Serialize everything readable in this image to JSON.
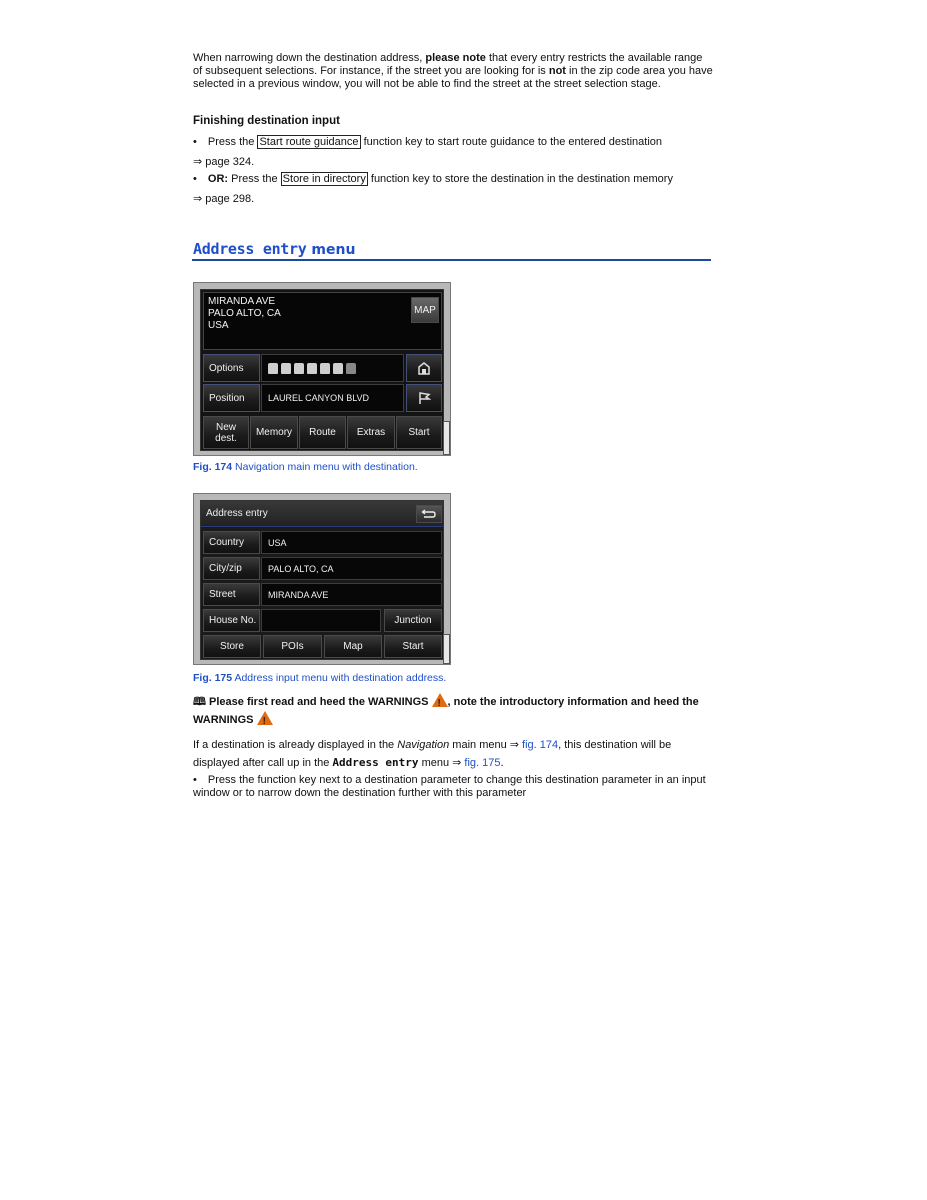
{
  "intro": {
    "p1_a": "When narrowing down the destination address, ",
    "p1_bold1": "please note",
    "p1_b": " that every entry restricts the available range of subsequent selections. For instance, if the street you are looking for is ",
    "p1_bold2": "not",
    "p1_c": " in the zip code area you have selected in a previous window, you will not be able to find the street at the street selection stage."
  },
  "finishing": {
    "heading": "Finishing destination input",
    "bullet1": {
      "pre": "Press the ",
      "key": "Start route guidance",
      "post": " function key to start route guidance to the entered destination",
      "ref": "⇒ page 324."
    },
    "bullet2": {
      "bold": "OR:",
      "pre": " Press the ",
      "key": "Store in directory",
      "post": " function key to store the destination in the destination memory",
      "ref": "⇒ page 298."
    }
  },
  "section": {
    "title_mono": "Address entry",
    "title_sans": " menu"
  },
  "fig174": {
    "destination_lines": [
      "MIRANDA AVE",
      "PALO ALTO, CA",
      "USA"
    ],
    "map_button": "MAP",
    "options_label": "Options",
    "position_label": "Position",
    "position_value": "LAUREL CANYON BLVD",
    "poi_icons": [
      "fuel-station-icon",
      "restaurant-icon",
      "parking-icon",
      "hotel-icon",
      "airport-icon",
      "information-icon",
      "landmark-icon"
    ],
    "bottom_buttons": [
      "New\ndest.",
      "Memory",
      "Route",
      "Extras",
      "Start"
    ],
    "caption_num": "Fig. 174",
    "caption_text": " Navigation main menu with destination."
  },
  "fig175": {
    "title": "Address entry",
    "rows": [
      {
        "label": "Country",
        "value": "USA"
      },
      {
        "label": "City/zip",
        "value": "PALO ALTO, CA"
      },
      {
        "label": "Street",
        "value": "MIRANDA AVE"
      },
      {
        "label": "House No.",
        "value": ""
      }
    ],
    "junction_button": "Junction",
    "bottom_buttons": [
      "Store",
      "POIs",
      "Map",
      "Start"
    ],
    "caption_num": "Fig. 175",
    "caption_text": " Address input menu with destination address."
  },
  "warning": {
    "book_icon": "🕮",
    "text_a": " Please first read and heed the WARNINGS ",
    "text_b": ", note the introductory information and heed the WARNINGS "
  },
  "para2": {
    "a": "If a destination is already displayed in the ",
    "italic": "Navigation",
    "b": " main menu ⇒ ",
    "link1": "fig. 174",
    "c": ", this destination will be displayed after call up in the ",
    "mono": "Address entry",
    "d": " menu ⇒ ",
    "link2": "fig. 175",
    "e": "."
  },
  "bullet3": "Press the function key next to a destination parameter to change this destination parameter in an input window or to narrow down the destination further with this parameter",
  "bullet_char": "•"
}
